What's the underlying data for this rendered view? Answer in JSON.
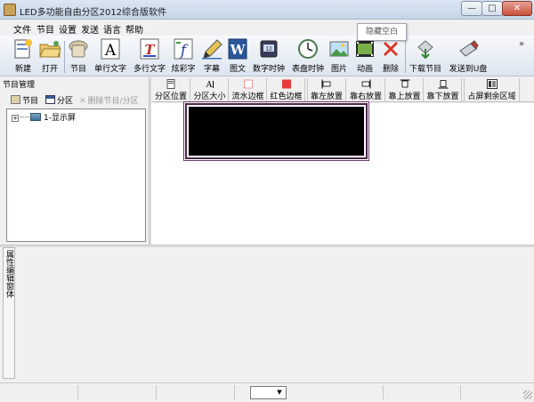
{
  "window": {
    "title": "LED多功能自由分区2012综合版软件",
    "icon": "app-logo-icon",
    "controls": {
      "minimize": "—",
      "maximize": "□",
      "close": "✕"
    }
  },
  "menu": [
    "文件",
    "节目",
    "设置",
    "发送",
    "语言",
    "帮助"
  ],
  "toolbar": [
    {
      "label": "新建",
      "icon": "new-icon"
    },
    {
      "label": "打开",
      "icon": "open-folder-icon"
    },
    {
      "label": "节目",
      "icon": "program-icon"
    },
    {
      "label": "单行文字",
      "icon": "single-line-text-icon"
    },
    {
      "label": "多行文字",
      "icon": "multi-line-text-icon"
    },
    {
      "label": "炫彩字",
      "icon": "color-text-icon"
    },
    {
      "label": "字幕",
      "icon": "subtitle-pen-icon"
    },
    {
      "label": "图文",
      "icon": "word-document-icon"
    },
    {
      "label": "数字时钟",
      "icon": "digital-clock-icon"
    },
    {
      "label": "表盘时钟",
      "icon": "analog-clock-icon"
    },
    {
      "label": "图片",
      "icon": "picture-icon"
    },
    {
      "label": "动画",
      "icon": "animation-icon"
    },
    {
      "label": "删除",
      "icon": "delete-x-icon"
    },
    {
      "label": "下载节目",
      "icon": "download-program-icon"
    },
    {
      "label": "发送到U盘",
      "icon": "usb-drive-icon"
    }
  ],
  "toolbar_more": "»",
  "tooltip": "隐藏空白",
  "program_panel": {
    "title": "节目管理",
    "actions": [
      {
        "label": "节目",
        "icon": "program-small-icon",
        "enabled": true
      },
      {
        "label": "分区",
        "icon": "zone-small-icon",
        "enabled": true
      },
      {
        "label": "删除节目/分区",
        "icon": "delete-small-icon",
        "enabled": false
      }
    ],
    "tree": [
      {
        "expander": "+",
        "label": "1-显示屏",
        "icon": "display-screen-icon"
      }
    ]
  },
  "zone_toolbar": [
    {
      "label": "分区位置",
      "icon": "zone-position-icon"
    },
    {
      "label": "分区大小",
      "icon": "zone-size-icon"
    },
    {
      "label": "流水边框",
      "icon": "flow-border-icon"
    },
    {
      "label": "红色边框",
      "icon": "red-border-icon"
    },
    {
      "label": "靠左放置",
      "icon": "align-left-icon"
    },
    {
      "label": "靠右放置",
      "icon": "align-right-icon"
    },
    {
      "label": "靠上放置",
      "icon": "align-top-icon"
    },
    {
      "label": "靠下放置",
      "icon": "align-bottom-icon"
    },
    {
      "label": "占屏剩余区域",
      "icon": "fill-remaining-icon"
    }
  ],
  "properties_panel": {
    "tab_label": "属性编辑窗体"
  },
  "statusbar": {
    "combo_value": ""
  },
  "colors": {
    "led_screen": "#000000",
    "led_border": "#6a3a6a",
    "title_bar": "#c6d5e8",
    "close_button": "#c8503a"
  }
}
